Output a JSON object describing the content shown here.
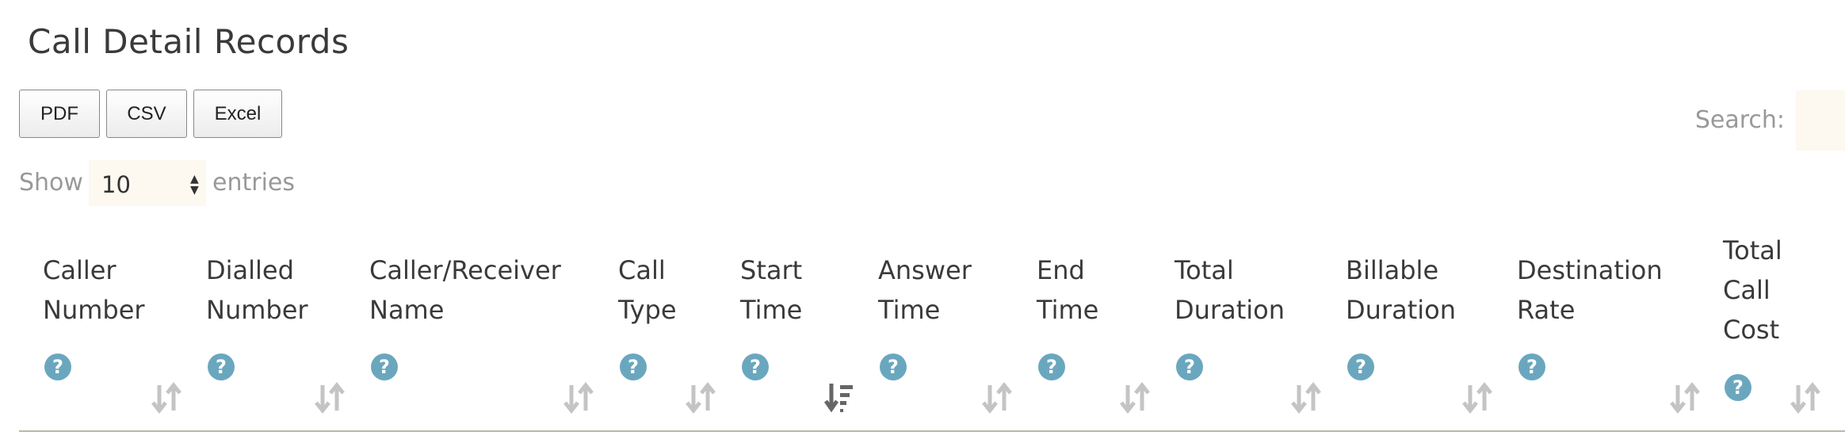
{
  "page": {
    "title": "Call Detail Records"
  },
  "toolbar": {
    "buttons": [
      "PDF",
      "CSV",
      "Excel"
    ]
  },
  "search": {
    "label": "Search:",
    "value": ""
  },
  "length": {
    "show_label": "Show",
    "value": "10",
    "entries_label": "entries"
  },
  "table": {
    "columns": [
      {
        "lines": [
          "Caller",
          "Number"
        ],
        "help": "?",
        "sort": "both"
      },
      {
        "lines": [
          "Dialled",
          "Number"
        ],
        "help": "?",
        "sort": "both"
      },
      {
        "lines": [
          "Caller/Receiver",
          "Name"
        ],
        "help": "?",
        "sort": "both"
      },
      {
        "lines": [
          "Call",
          "Type"
        ],
        "help": "?",
        "sort": "both"
      },
      {
        "lines": [
          "Start",
          "Time"
        ],
        "help": "?",
        "sort": "desc"
      },
      {
        "lines": [
          "Answer",
          "Time"
        ],
        "help": "?",
        "sort": "both"
      },
      {
        "lines": [
          "End",
          "Time"
        ],
        "help": "?",
        "sort": "both"
      },
      {
        "lines": [
          "Total",
          "Duration"
        ],
        "help": "?",
        "sort": "both"
      },
      {
        "lines": [
          "Billable",
          "Duration"
        ],
        "help": "?",
        "sort": "both"
      },
      {
        "lines": [
          "Destination",
          "Rate"
        ],
        "help": "?",
        "sort": "both"
      },
      {
        "lines": [
          "Total",
          "Call",
          "Cost"
        ],
        "help": "?",
        "sort": "both"
      }
    ]
  },
  "icons": {
    "help": "question-circle-icon",
    "sort_both": "sort-both-icon",
    "sort_desc": "sort-desc-icon"
  },
  "colors": {
    "help_icon": "#6aa7be",
    "sort_inactive": "#c4c4c4",
    "sort_active": "#666666",
    "input_bg": "#fdf8f0",
    "header_rule": "#b7b9a4"
  }
}
